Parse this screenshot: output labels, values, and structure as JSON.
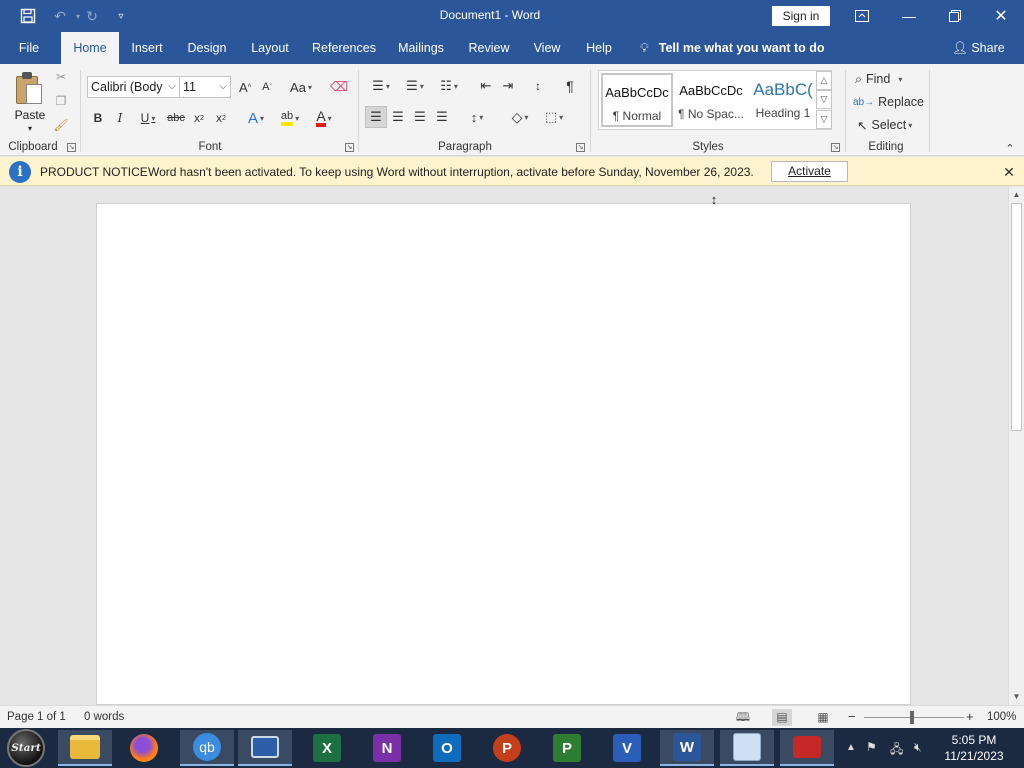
{
  "titlebar": {
    "title": "Document1  -  Word",
    "sign_in": "Sign in"
  },
  "tabs": [
    "File",
    "Home",
    "Insert",
    "Design",
    "Layout",
    "References",
    "Mailings",
    "Review",
    "View",
    "Help"
  ],
  "active_tab": "Home",
  "tell_me": "Tell me what you want to do",
  "share": "Share",
  "ribbon": {
    "clipboard": {
      "label": "Clipboard",
      "paste": "Paste"
    },
    "font": {
      "label": "Font",
      "name": "Calibri (Body",
      "size": "11",
      "change_case": "Aa"
    },
    "paragraph": {
      "label": "Paragraph"
    },
    "styles": {
      "label": "Styles",
      "items": [
        {
          "preview": "AaBbCcDc",
          "name": "¶ Normal"
        },
        {
          "preview": "AaBbCcDc",
          "name": "¶ No Spac..."
        },
        {
          "preview": "AaBbC(",
          "name": "Heading 1"
        }
      ]
    },
    "editing": {
      "label": "Editing",
      "find": "Find",
      "replace": "Replace",
      "select": "Select"
    }
  },
  "notice": {
    "title": "PRODUCT NOTICE",
    "message": "Word hasn't been activated. To keep using Word without interruption, activate before Sunday, November 26, 2023.",
    "button": "Activate"
  },
  "status": {
    "page": "Page 1 of 1",
    "words": "0 words",
    "zoom": "100%"
  },
  "taskbar": {
    "start": "Start",
    "time": "5:05 PM",
    "date": "11/21/2023",
    "apps": [
      {
        "name": "file-explorer",
        "glyph": ""
      },
      {
        "name": "firefox",
        "glyph": ""
      },
      {
        "name": "qbittorrent",
        "glyph": "qb"
      },
      {
        "name": "remote-desktop",
        "glyph": ""
      },
      {
        "name": "excel",
        "glyph": "X"
      },
      {
        "name": "onenote",
        "glyph": "N"
      },
      {
        "name": "outlook",
        "glyph": "O"
      },
      {
        "name": "powerpoint",
        "glyph": "P"
      },
      {
        "name": "project",
        "glyph": "P"
      },
      {
        "name": "visio",
        "glyph": "V"
      },
      {
        "name": "word",
        "glyph": "W"
      },
      {
        "name": "control-panel",
        "glyph": ""
      },
      {
        "name": "toolbox",
        "glyph": ""
      }
    ]
  },
  "colors": {
    "word_blue": "#2b579a",
    "notice_bg": "#fff4ce",
    "taskbar": "#1b2a41"
  }
}
